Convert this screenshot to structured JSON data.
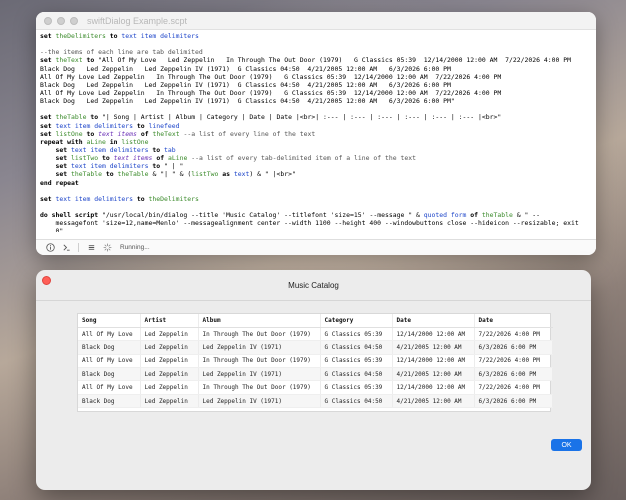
{
  "editor": {
    "title": "swiftDialog Example.scpt",
    "status": "Running..."
  },
  "code_lines": [
    [
      {
        "t": "set ",
        "c": "kw"
      },
      {
        "t": "theDelimiters",
        "c": "var"
      },
      {
        "t": " to ",
        "c": "kw"
      },
      {
        "t": "text item delimiters",
        "c": "cmd"
      }
    ],
    [],
    [
      {
        "t": "--the items of each line are tab delimited",
        "c": "cmt"
      }
    ],
    [
      {
        "t": "set ",
        "c": "kw"
      },
      {
        "t": "theText",
        "c": "var"
      },
      {
        "t": " to ",
        "c": "kw"
      },
      {
        "t": "\"All Of My Love   Led Zeppelin   In Through The Out Door (1979)   G Classics 05:39  12/14/2000 12:00 AM  7/22/2026 4:00 PM",
        "c": "str"
      }
    ],
    [
      {
        "t": "Black Dog   Led Zeppelin   Led Zeppelin IV (1971)  G Classics 04:50  4/21/2005 12:00 AM   6/3/2026 6:00 PM",
        "c": "str"
      }
    ],
    [
      {
        "t": "All Of My Love Led Zeppelin   In Through The Out Door (1979)   G Classics 05:39  12/14/2000 12:00 AM  7/22/2026 4:00 PM",
        "c": "str"
      }
    ],
    [
      {
        "t": "Black Dog   Led Zeppelin   Led Zeppelin IV (1971)  G Classics 04:50  4/21/2005 12:00 AM   6/3/2026 6:00 PM",
        "c": "str"
      }
    ],
    [
      {
        "t": "All Of My Love Led Zeppelin   In Through The Out Door (1979)   G Classics 05:39  12/14/2000 12:00 AM  7/22/2026 4:00 PM",
        "c": "str"
      }
    ],
    [
      {
        "t": "Black Dog   Led Zeppelin   Led Zeppelin IV (1971)  G Classics 04:50  4/21/2005 12:00 AM   6/3/2026 6:00 PM\"",
        "c": "str"
      }
    ],
    [],
    [
      {
        "t": "set ",
        "c": "kw"
      },
      {
        "t": "theTable",
        "c": "var"
      },
      {
        "t": " to ",
        "c": "kw"
      },
      {
        "t": "\"| Song | Artist | Album | Category | Date | Date |<br>| :--- | :--- | :--- | :--- | :--- | :--- |<br>\"",
        "c": "str"
      }
    ],
    [
      {
        "t": "set ",
        "c": "kw"
      },
      {
        "t": "text item delimiters",
        "c": "cmd"
      },
      {
        "t": " to ",
        "c": "kw"
      },
      {
        "t": "linefeed",
        "c": "cmd"
      }
    ],
    [
      {
        "t": "set ",
        "c": "kw"
      },
      {
        "t": "listOne",
        "c": "var"
      },
      {
        "t": " to ",
        "c": "kw"
      },
      {
        "t": "text items",
        "c": "ita"
      },
      {
        "t": " of ",
        "c": "kw"
      },
      {
        "t": "theText",
        "c": "var"
      },
      {
        "t": " --a list of every line of the text",
        "c": "cmt"
      }
    ],
    [
      {
        "t": "repeat with ",
        "c": "kw"
      },
      {
        "t": "aLine",
        "c": "var"
      },
      {
        "t": " in ",
        "c": "kw"
      },
      {
        "t": "listOne",
        "c": "var"
      }
    ],
    [
      {
        "t": "    set ",
        "c": "kw"
      },
      {
        "t": "text item delimiters",
        "c": "cmd"
      },
      {
        "t": " to ",
        "c": "kw"
      },
      {
        "t": "tab",
        "c": "cmd"
      }
    ],
    [
      {
        "t": "    set ",
        "c": "kw"
      },
      {
        "t": "listTwo",
        "c": "var"
      },
      {
        "t": " to ",
        "c": "kw"
      },
      {
        "t": "text items",
        "c": "ita"
      },
      {
        "t": " of ",
        "c": "kw"
      },
      {
        "t": "aLine",
        "c": "var"
      },
      {
        "t": " --a list of every tab-delimited item of a line of the text",
        "c": "cmt"
      }
    ],
    [
      {
        "t": "    set ",
        "c": "kw"
      },
      {
        "t": "text item delimiters",
        "c": "cmd"
      },
      {
        "t": " to ",
        "c": "kw"
      },
      {
        "t": "\" | \"",
        "c": "str"
      }
    ],
    [
      {
        "t": "    set ",
        "c": "kw"
      },
      {
        "t": "theTable",
        "c": "var"
      },
      {
        "t": " to ",
        "c": "kw"
      },
      {
        "t": "theTable",
        "c": "var"
      },
      {
        "t": " & \"| \" & (",
        "c": "str"
      },
      {
        "t": "listTwo",
        "c": "var"
      },
      {
        "t": " as ",
        "c": "kw"
      },
      {
        "t": "text",
        "c": "cmd"
      },
      {
        "t": ") & \" |<br>\"",
        "c": "str"
      }
    ],
    [
      {
        "t": "end repeat",
        "c": "kw"
      }
    ],
    [],
    [
      {
        "t": "set ",
        "c": "kw"
      },
      {
        "t": "text item delimiters",
        "c": "cmd"
      },
      {
        "t": " to ",
        "c": "kw"
      },
      {
        "t": "theDelimiters",
        "c": "var"
      }
    ],
    [],
    [
      {
        "t": "do shell script ",
        "c": "kw"
      },
      {
        "t": "\"/usr/local/bin/dialog --title 'Music Catalog' --titlefont 'size=15' --message \" & ",
        "c": "str"
      },
      {
        "t": "quoted form",
        "c": "cmd"
      },
      {
        "t": " of ",
        "c": "kw"
      },
      {
        "t": "theTable",
        "c": "var"
      },
      {
        "t": " & \" --",
        "c": "str"
      }
    ],
    [
      {
        "t": "    messagefont 'size=12,name=Menlo' --messagealignment center --width 1100 --height 400 --windowbuttons close --hideicon --resizable; exit",
        "c": "str"
      }
    ],
    [
      {
        "t": "    0\"",
        "c": "str"
      }
    ]
  ],
  "dialog": {
    "title": "Music Catalog",
    "ok_label": "OK",
    "columns": [
      "Song",
      "Artist",
      "Album",
      "Category",
      "Date",
      "Date"
    ],
    "rows": [
      [
        "All Of My Love",
        "Led Zeppelin",
        "In Through The Out Door (1979)",
        "G Classics 05:39",
        "12/14/2000 12:00 AM",
        "7/22/2026 4:00 PM"
      ],
      [
        "Black Dog",
        "Led Zeppelin",
        "Led Zeppelin IV (1971)",
        "G Classics 04:50",
        "4/21/2005 12:00 AM",
        "6/3/2026 6:00 PM"
      ],
      [
        "All Of My Love",
        "Led Zeppelin",
        "In Through The Out Door (1979)",
        "G Classics 05:39",
        "12/14/2000 12:00 AM",
        "7/22/2026 4:00 PM"
      ],
      [
        "Black Dog",
        "Led Zeppelin",
        "Led Zeppelin IV (1971)",
        "G Classics 04:50",
        "4/21/2005 12:00 AM",
        "6/3/2026 6:00 PM"
      ],
      [
        "All Of My Love",
        "Led Zeppelin",
        "In Through The Out Door (1979)",
        "G Classics 05:39",
        "12/14/2000 12:00 AM",
        "7/22/2026 4:00 PM"
      ],
      [
        "Black Dog",
        "Led Zeppelin",
        "Led Zeppelin IV (1971)",
        "G Classics 04:50",
        "4/21/2005 12:00 AM",
        "6/3/2026 6:00 PM"
      ]
    ]
  },
  "colors": {
    "accent": "#1a73e8",
    "close": "#ff5f57",
    "variable": "#3a8a2a",
    "command": "#1c44c9",
    "italic_command": "#6a2fb6"
  },
  "icons": [
    "info-icon",
    "log-icon",
    "list-icon",
    "spinner-icon"
  ]
}
